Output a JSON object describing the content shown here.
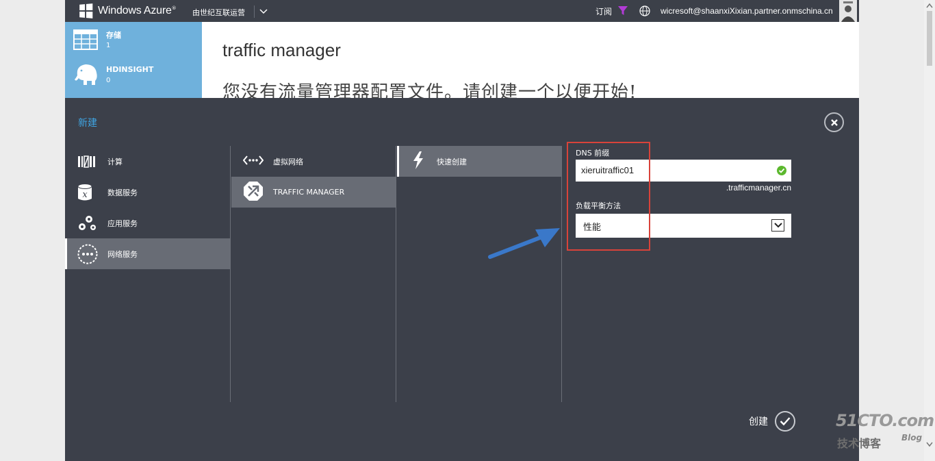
{
  "topbar": {
    "brand": "Windows Azure",
    "operator": "由世纪互联运营",
    "subscriptions_label": "订阅",
    "account": "wicresoft@shaanxiXixian.partner.onmschina.cn"
  },
  "leftnav": {
    "items": [
      {
        "label": "存储",
        "count": "1",
        "icon": "table-grid-icon"
      },
      {
        "label": "HDINSIGHT",
        "count": "0",
        "icon": "elephant-icon"
      }
    ]
  },
  "main": {
    "title": "traffic manager",
    "empty_message": "您没有流量管理器配置文件。请创建一个以便开始!"
  },
  "dialog": {
    "title": "新建",
    "categories": [
      {
        "label": "计算",
        "icon": "compute-icon"
      },
      {
        "label": "数据服务",
        "icon": "data-services-icon"
      },
      {
        "label": "应用服务",
        "icon": "app-services-icon"
      },
      {
        "label": "网络服务",
        "icon": "network-services-icon",
        "selected": true
      }
    ],
    "services": [
      {
        "label": "虚拟网络",
        "icon": "virtual-network-icon"
      },
      {
        "label": "TRAFFIC MANAGER",
        "icon": "traffic-manager-icon",
        "selected": true
      }
    ],
    "methods": [
      {
        "label": "快速创建",
        "icon": "lightning-icon",
        "selected": true
      }
    ],
    "form": {
      "dns_label": "DNS 前缀",
      "dns_value": "xieruitraffic01",
      "dns_suffix": ".trafficmanager.cn",
      "lb_label": "负载平衡方法",
      "lb_value": "性能"
    },
    "create_label": "创建"
  },
  "watermark": {
    "line1": "51CTO.com",
    "line2": "技术博客",
    "line3": "Blog"
  },
  "colors": {
    "topbar": "#3c4049",
    "dialog": "#3c404a",
    "accent": "#3fa3e0",
    "highlight_box": "#d9433a",
    "arrow": "#3a78c9",
    "valid": "#5cb82e"
  }
}
